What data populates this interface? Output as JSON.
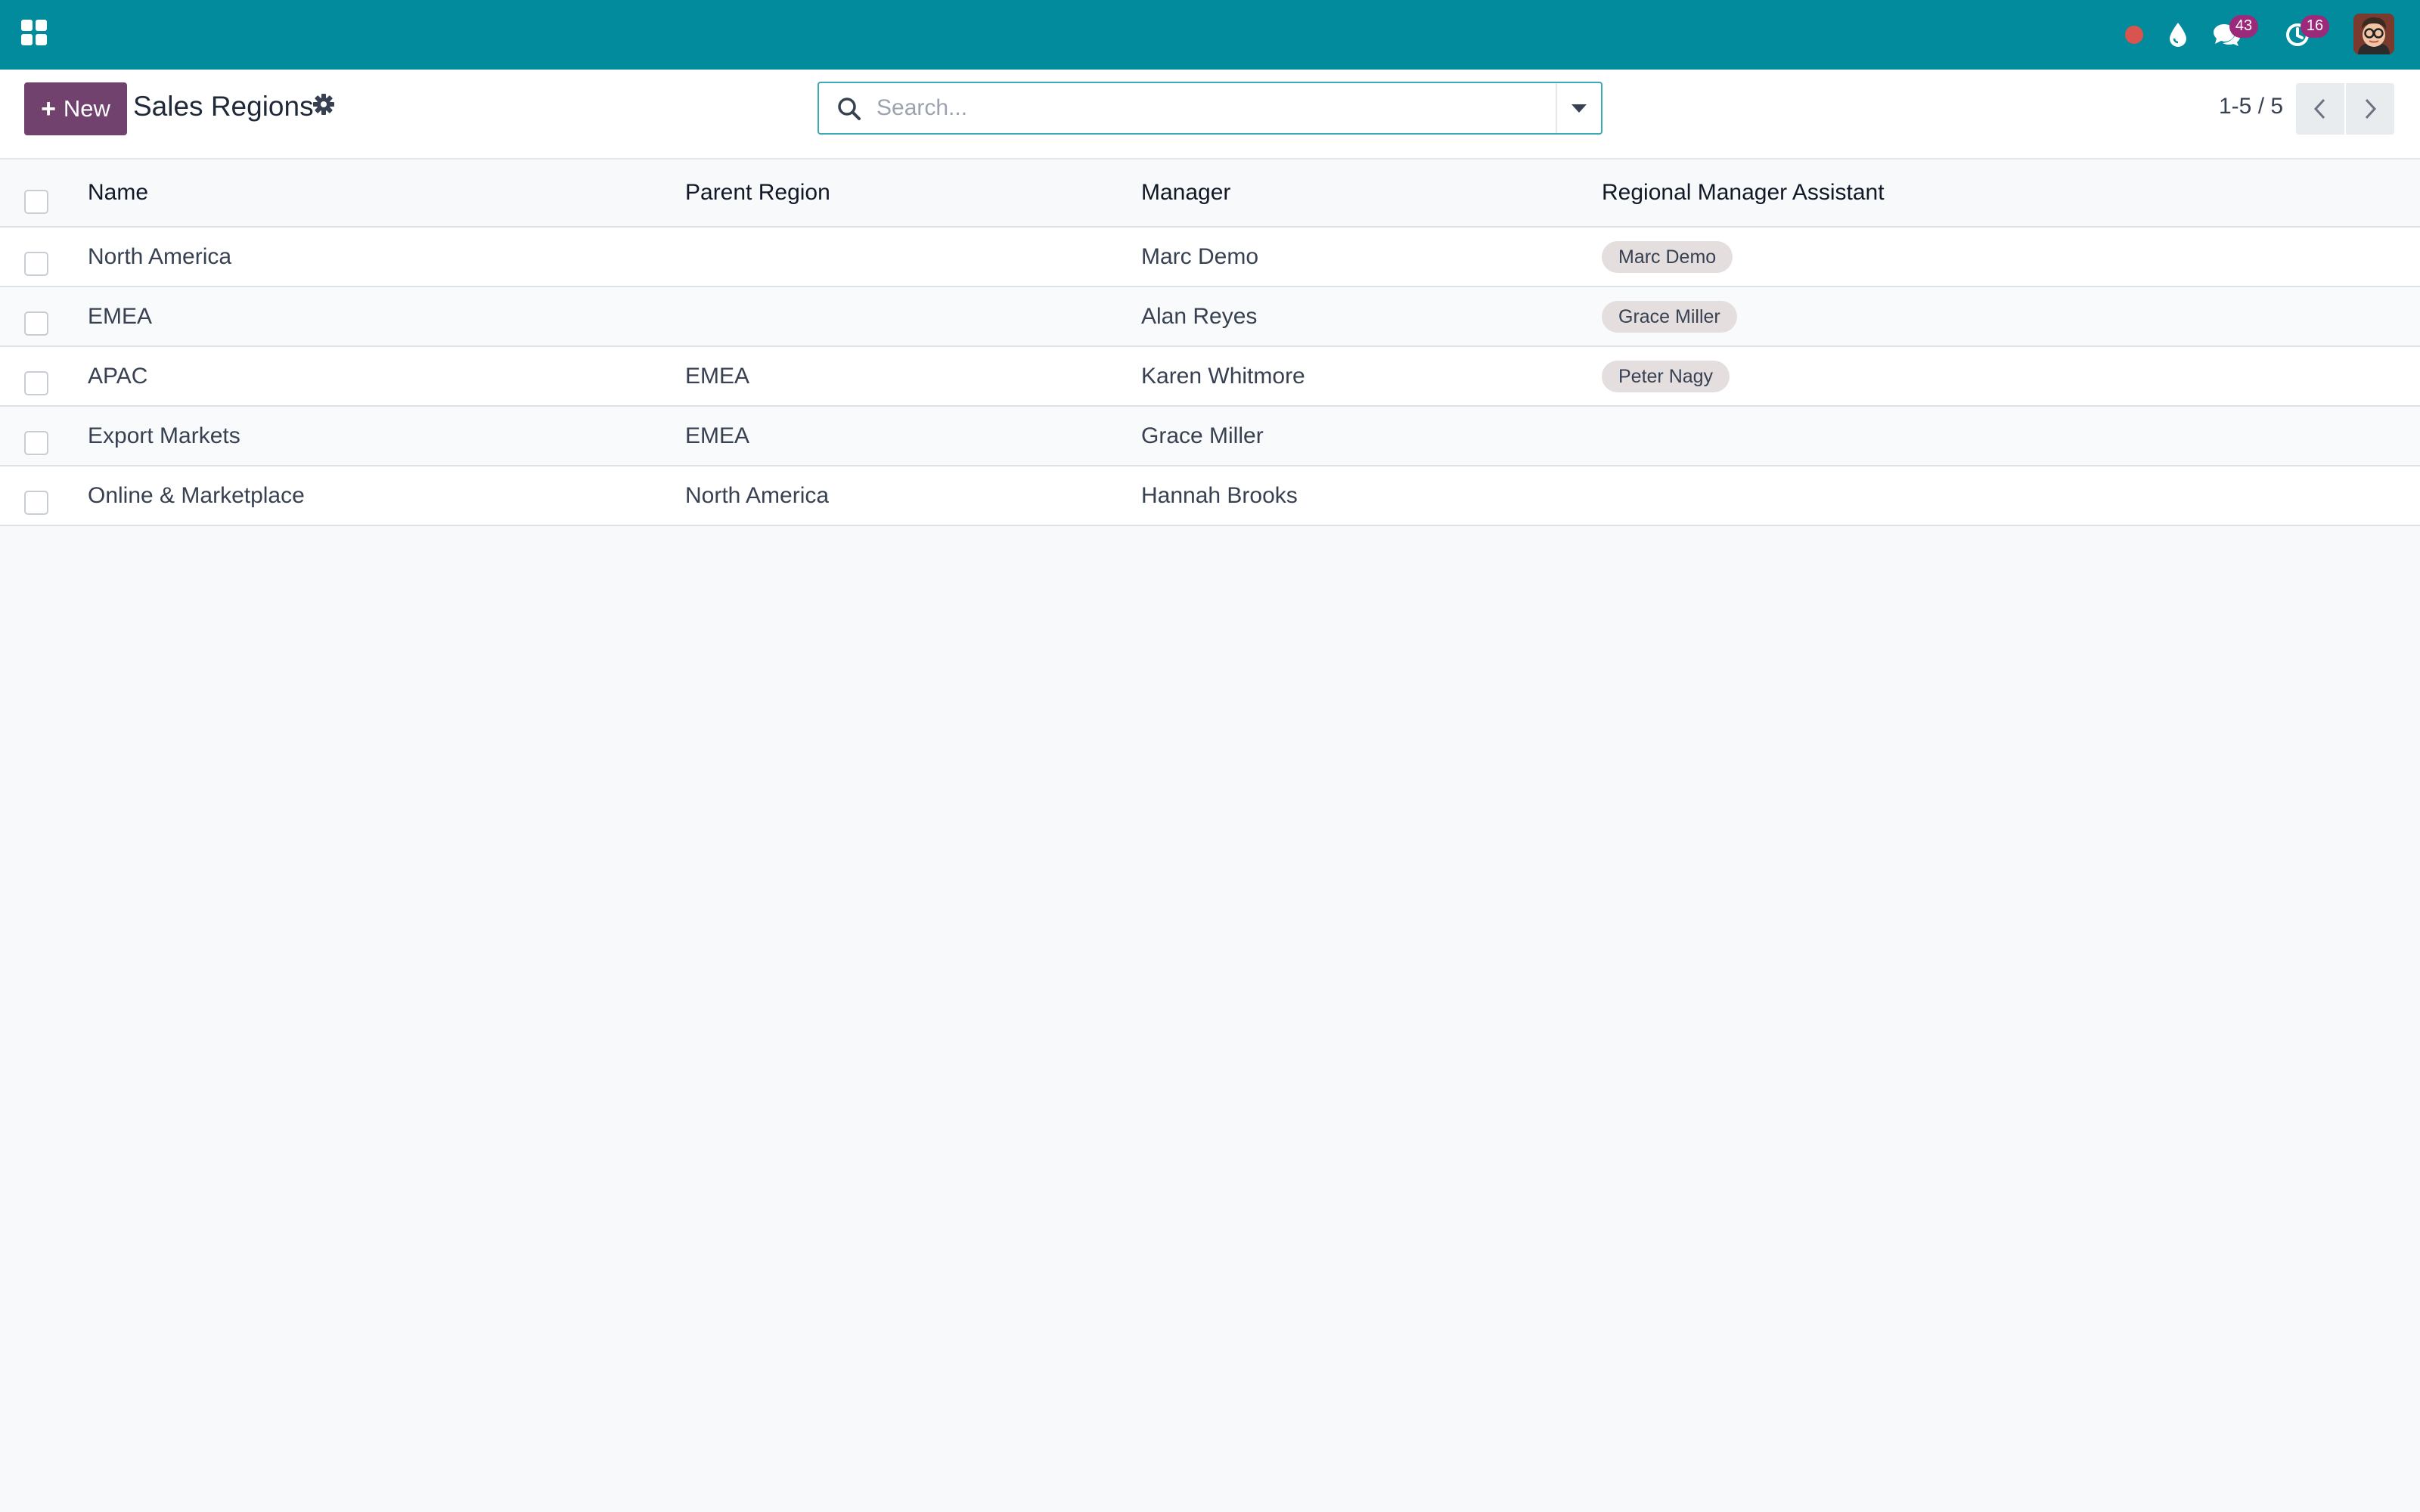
{
  "navbar": {
    "messages_count": "43",
    "activities_count": "16"
  },
  "control_panel": {
    "new_label": "New",
    "title": "Sales Regions",
    "search_placeholder": "Search...",
    "pager_value": "1-5 / 5"
  },
  "table": {
    "headers": {
      "name": "Name",
      "parent": "Parent Region",
      "manager": "Manager",
      "assistant": "Regional Manager Assistant"
    },
    "rows": [
      {
        "name": "North America",
        "parent": "",
        "manager": "Marc Demo",
        "assistant": "Marc Demo"
      },
      {
        "name": "EMEA",
        "parent": "",
        "manager": "Alan Reyes",
        "assistant": "Grace Miller"
      },
      {
        "name": "APAC",
        "parent": "EMEA",
        "manager": "Karen Whitmore",
        "assistant": "Peter Nagy"
      },
      {
        "name": "Export Markets",
        "parent": "EMEA",
        "manager": "Grace Miller",
        "assistant": ""
      },
      {
        "name": "Online & Marketplace",
        "parent": "North America",
        "manager": "Hannah Brooks",
        "assistant": ""
      }
    ]
  },
  "colors": {
    "navbar": "#018b9c",
    "primary_button": "#71426e",
    "badge": "#9c2a7b",
    "recording_dot": "#d9534f"
  }
}
